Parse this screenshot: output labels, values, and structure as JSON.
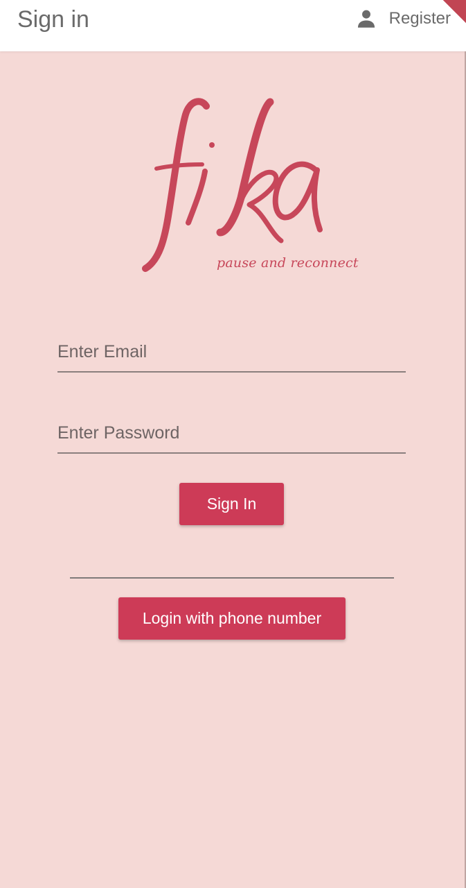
{
  "appbar": {
    "title": "Sign in",
    "register_label": "Register",
    "register_icon": "person-icon"
  },
  "logo": {
    "wordmark": "fika",
    "tagline": "pause and reconnect",
    "color": "#c7475a"
  },
  "form": {
    "email_placeholder": "Enter Email",
    "email_value": "",
    "password_placeholder": "Enter Password",
    "password_value": "",
    "sign_in_label": "Sign In",
    "phone_login_label": "Login with phone number"
  },
  "colors": {
    "background": "#f5d9d6",
    "accent": "#cd3b57",
    "appbar": "#ffffff"
  }
}
